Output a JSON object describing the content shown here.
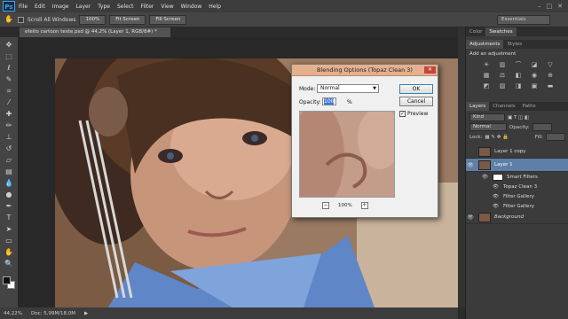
{
  "app": {
    "logo": "Ps"
  },
  "menu": [
    "File",
    "Edit",
    "Image",
    "Layer",
    "Type",
    "Select",
    "Filter",
    "View",
    "Window",
    "Help"
  ],
  "window_controls": {
    "minimize": "–",
    "maximize": "□",
    "close": "✕"
  },
  "options_bar": {
    "scroll_all": "Scroll All Windows",
    "zoom_btn": "100%",
    "fit_btn": "Fit Screen",
    "fill_btn": "Fill Screen",
    "workspace": "Essentials"
  },
  "document_tab": "efeito cartoon teste.psd @ 44,2% (Layer 1, RGB/8#) *",
  "status": {
    "zoom": "44,22%",
    "doc": "Doc: 5,99M/18,0M"
  },
  "panels": {
    "top_tabs": [
      "Color",
      "Swatches"
    ],
    "adj_tabs": [
      "Adjustments",
      "Styles"
    ],
    "adj_title": "Add an adjustment",
    "layer_tabs": [
      "Layers",
      "Channels",
      "Paths"
    ],
    "kind_label": "Kind",
    "blend_mode": "Normal",
    "opacity_label": "Opacity:",
    "lock_label": "Lock:",
    "fill_label": "Fill:"
  },
  "layers": [
    {
      "name": "Layer 1 copy",
      "selected": false
    },
    {
      "name": "Layer 1",
      "selected": true
    },
    {
      "name": "Background",
      "selected": false
    }
  ],
  "smart_filters": {
    "label": "Smart Filters",
    "items": [
      "Topaz Clean 3",
      "Filter Gallery",
      "Filter Gallery"
    ]
  },
  "dialog": {
    "title": "Blending Options (Topaz Clean 3)",
    "mode_label": "Mode:",
    "mode_value": "Normal",
    "opacity_label": "Opacity:",
    "opacity_value": "100",
    "percent": "%",
    "ok": "OK",
    "cancel": "Cancel",
    "preview_label": "Preview",
    "zoom_value": "100%"
  }
}
